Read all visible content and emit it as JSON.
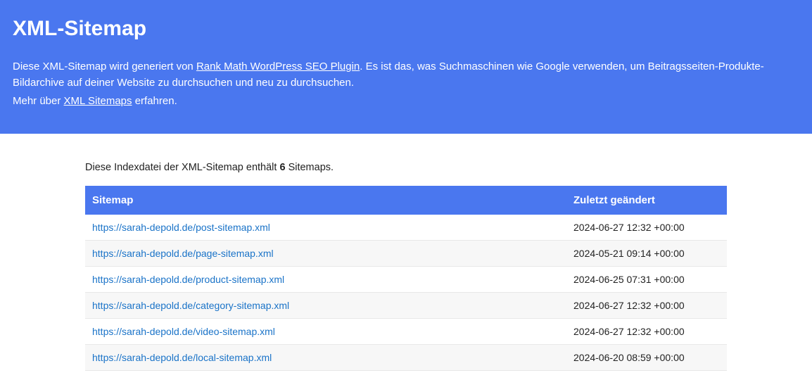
{
  "header": {
    "title": "XML-Sitemap",
    "intro_before": "Diese XML-Sitemap wird generiert von ",
    "intro_link": "Rank Math WordPress SEO Plugin",
    "intro_after": ". Es ist das, was Suchmaschinen wie Google verwenden, um Beitragsseiten-Produkte-Bildarchive auf deiner Website zu durchsuchen und neu zu durchsuchen.",
    "more_before": "Mehr über ",
    "more_link": "XML Sitemaps",
    "more_after": " erfahren."
  },
  "count_line": {
    "before": "Diese Indexdatei der XML-Sitemap enthält ",
    "count": "6",
    "after": " Sitemaps."
  },
  "table": {
    "col_sitemap": "Sitemap",
    "col_modified": "Zuletzt geändert",
    "rows": [
      {
        "url": "https://sarah-depold.de/post-sitemap.xml",
        "modified": "2024-06-27 12:32 +00:00"
      },
      {
        "url": "https://sarah-depold.de/page-sitemap.xml",
        "modified": "2024-05-21 09:14 +00:00"
      },
      {
        "url": "https://sarah-depold.de/product-sitemap.xml",
        "modified": "2024-06-25 07:31 +00:00"
      },
      {
        "url": "https://sarah-depold.de/category-sitemap.xml",
        "modified": "2024-06-27 12:32 +00:00"
      },
      {
        "url": "https://sarah-depold.de/video-sitemap.xml",
        "modified": "2024-06-27 12:32 +00:00"
      },
      {
        "url": "https://sarah-depold.de/local-sitemap.xml",
        "modified": "2024-06-20 08:59 +00:00"
      }
    ]
  }
}
